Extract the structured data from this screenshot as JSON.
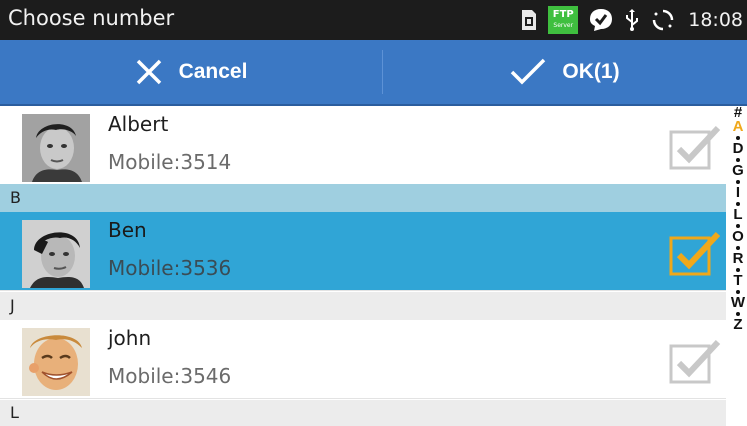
{
  "status_bar": {
    "title": "Choose number",
    "time": "18:08",
    "icons": [
      "sim-card-icon",
      "ftp-server-icon",
      "check-bubble-icon",
      "usb-icon",
      "sync-icon"
    ],
    "ftp_label": "FTP",
    "ftp_sub": "Server"
  },
  "action_bar": {
    "cancel_label": "Cancel",
    "ok_label": "OK(1)",
    "color": "#3b78c4"
  },
  "contacts": [
    {
      "name": "Albert",
      "phone": "Mobile:3514",
      "checked": false
    },
    {
      "name": "Ben",
      "phone": "Mobile:3536",
      "checked": true
    },
    {
      "name": "john",
      "phone": "Mobile:3546",
      "checked": false
    }
  ],
  "sections": [
    "B",
    "J",
    "L"
  ],
  "alphabet_index": [
    "#",
    "A",
    "D",
    "G",
    "I",
    "L",
    "O",
    "R",
    "T",
    "W",
    "Z"
  ],
  "colors": {
    "selected_row": "#30a5d6",
    "checkbox_checked": "#f0a81a",
    "index_highlight": "#f0a81a"
  }
}
